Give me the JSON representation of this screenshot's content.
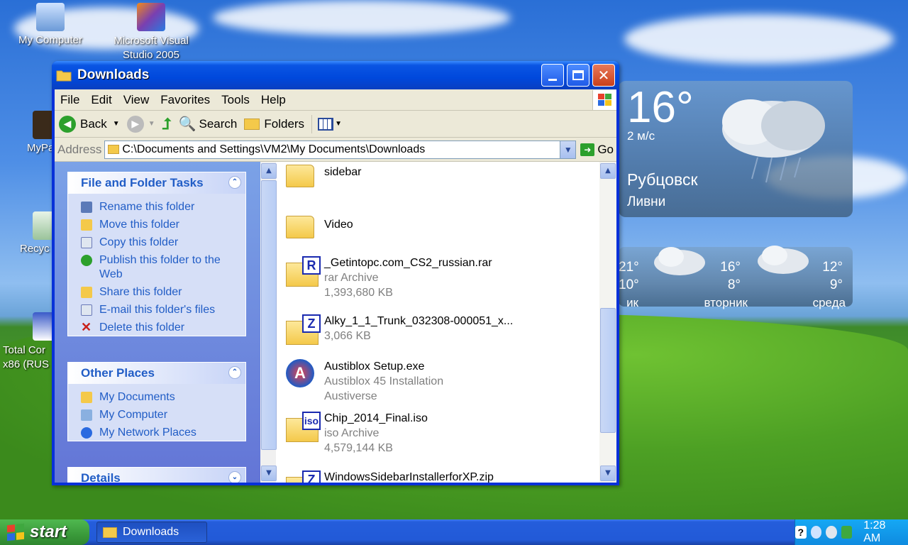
{
  "desktop": {
    "icons": [
      {
        "label": "My Computer"
      },
      {
        "label": "Microsoft Visual Studio 2005"
      },
      {
        "label": "MyPa"
      },
      {
        "label": "Recyc"
      },
      {
        "label": "Total Cor x86 (RUS"
      }
    ]
  },
  "weather": {
    "temperature": "16°",
    "wind": "2 м/с",
    "city": "Рубцовск",
    "region": "Ливни",
    "forecast": [
      {
        "high": "21°",
        "low": "10°",
        "day": "ик"
      },
      {
        "high": "16°",
        "low": "8°",
        "day": "вторник"
      },
      {
        "high": "12°",
        "low": "9°",
        "day": "среда"
      }
    ]
  },
  "window": {
    "title": "Downloads",
    "menu": [
      "File",
      "Edit",
      "View",
      "Favorites",
      "Tools",
      "Help"
    ],
    "toolbar": {
      "back": "Back",
      "search": "Search",
      "folders": "Folders"
    },
    "address": {
      "label": "Address",
      "value": "C:\\Documents and Settings\\VM2\\My Documents\\Downloads",
      "go": "Go"
    },
    "file_tasks": {
      "title": "File and Folder Tasks",
      "items": [
        "Rename this folder",
        "Move this folder",
        "Copy this folder",
        "Publish this folder to the Web",
        "Share this folder",
        "E-mail this folder's files",
        "Delete this folder"
      ]
    },
    "other_places": {
      "title": "Other Places",
      "items": [
        "My Documents",
        "My Computer",
        "My Network Places"
      ]
    },
    "details": {
      "title": "Details"
    },
    "files": [
      {
        "name": "sidebar",
        "type": "folder"
      },
      {
        "name": "Video",
        "type": "folder"
      },
      {
        "name": "_Getintopc.com_CS2_russian.rar",
        "line2": "rar Archive",
        "line3": "1,393,680 KB",
        "tag": "R"
      },
      {
        "name": "Alky_1_1_Trunk_032308-000051_x...",
        "line2": "3,066 KB",
        "tag": "Z"
      },
      {
        "name": "Austiblox Setup.exe",
        "line2": "Austiblox 45 Installation",
        "line3": "Austiverse",
        "tag": "A"
      },
      {
        "name": "Chip_2014_Final.iso",
        "line2": "iso Archive",
        "line3": "4,579,144 KB",
        "tag": "iso"
      },
      {
        "name": "WindowsSidebarInstallerforXP.zip",
        "tag": "Z"
      }
    ]
  },
  "taskbar": {
    "start": "start",
    "task": "Downloads",
    "clock": "1:28 AM"
  },
  "colors": {
    "link": "#215dc6",
    "titlebar": "#0048dc",
    "taskbar": "#225ad8"
  }
}
